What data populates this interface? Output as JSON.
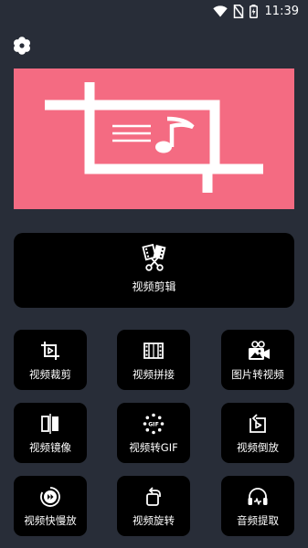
{
  "status_bar": {
    "time": "11:39"
  },
  "main_card": {
    "label": "视频剪辑"
  },
  "tiles": [
    {
      "label": "视频裁剪"
    },
    {
      "label": "视频拼接"
    },
    {
      "label": "图片转视频"
    },
    {
      "label": "视频镜像"
    },
    {
      "label": "视频转GIF"
    },
    {
      "label": "视频倒放"
    },
    {
      "label": "视频快慢放"
    },
    {
      "label": "视频旋转"
    },
    {
      "label": "音频提取"
    }
  ],
  "colors": {
    "background": "#282d38",
    "banner": "#f46b82",
    "card": "#000000"
  }
}
